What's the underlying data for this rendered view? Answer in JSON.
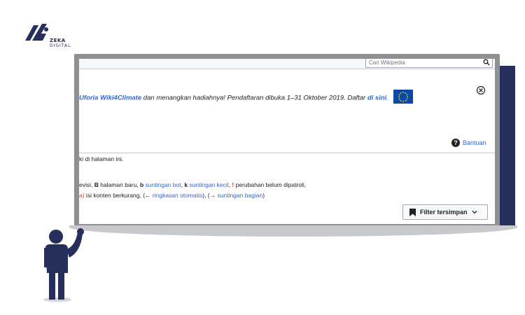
{
  "logo": {
    "line1": "ZEKA",
    "line2": "DIGITAL"
  },
  "search": {
    "placeholder": "Cari Wikipedia"
  },
  "banner": {
    "link1": "Uforia Wiki4Climate",
    "text": " dan menangkan hadiahnya! Pendaftaran dibuka 1–31 Oktober 2019. Daftar ",
    "link2": "di sini",
    "period": "."
  },
  "help": {
    "label": "Bantuan"
  },
  "content": {
    "line1": "ki di halaman ini.",
    "legend": {
      "p1": "evisi, ",
      "b_key": "B",
      "p2": " halaman baru, ",
      "bot_key": "b",
      "bot_label": "suntingan bot",
      "p3": ", ",
      "k_key": "k",
      "k_label": "suntingan kecil",
      "p4": ", ",
      "excl": "!",
      "p5": " perubahan belum dipatroli,"
    },
    "legend2": {
      "red": "a)",
      "p1": " isi konten berkurang, (← ",
      "link1": "ringkasan otomatis",
      "p2": "), (→ ",
      "link2": "suntingan bagian",
      "p3": ")"
    }
  },
  "filter_button": {
    "label": "Filter tersimpan"
  },
  "colors": {
    "navy": "#262e5c",
    "link": "#3366cc",
    "frame": "#8f9094"
  }
}
